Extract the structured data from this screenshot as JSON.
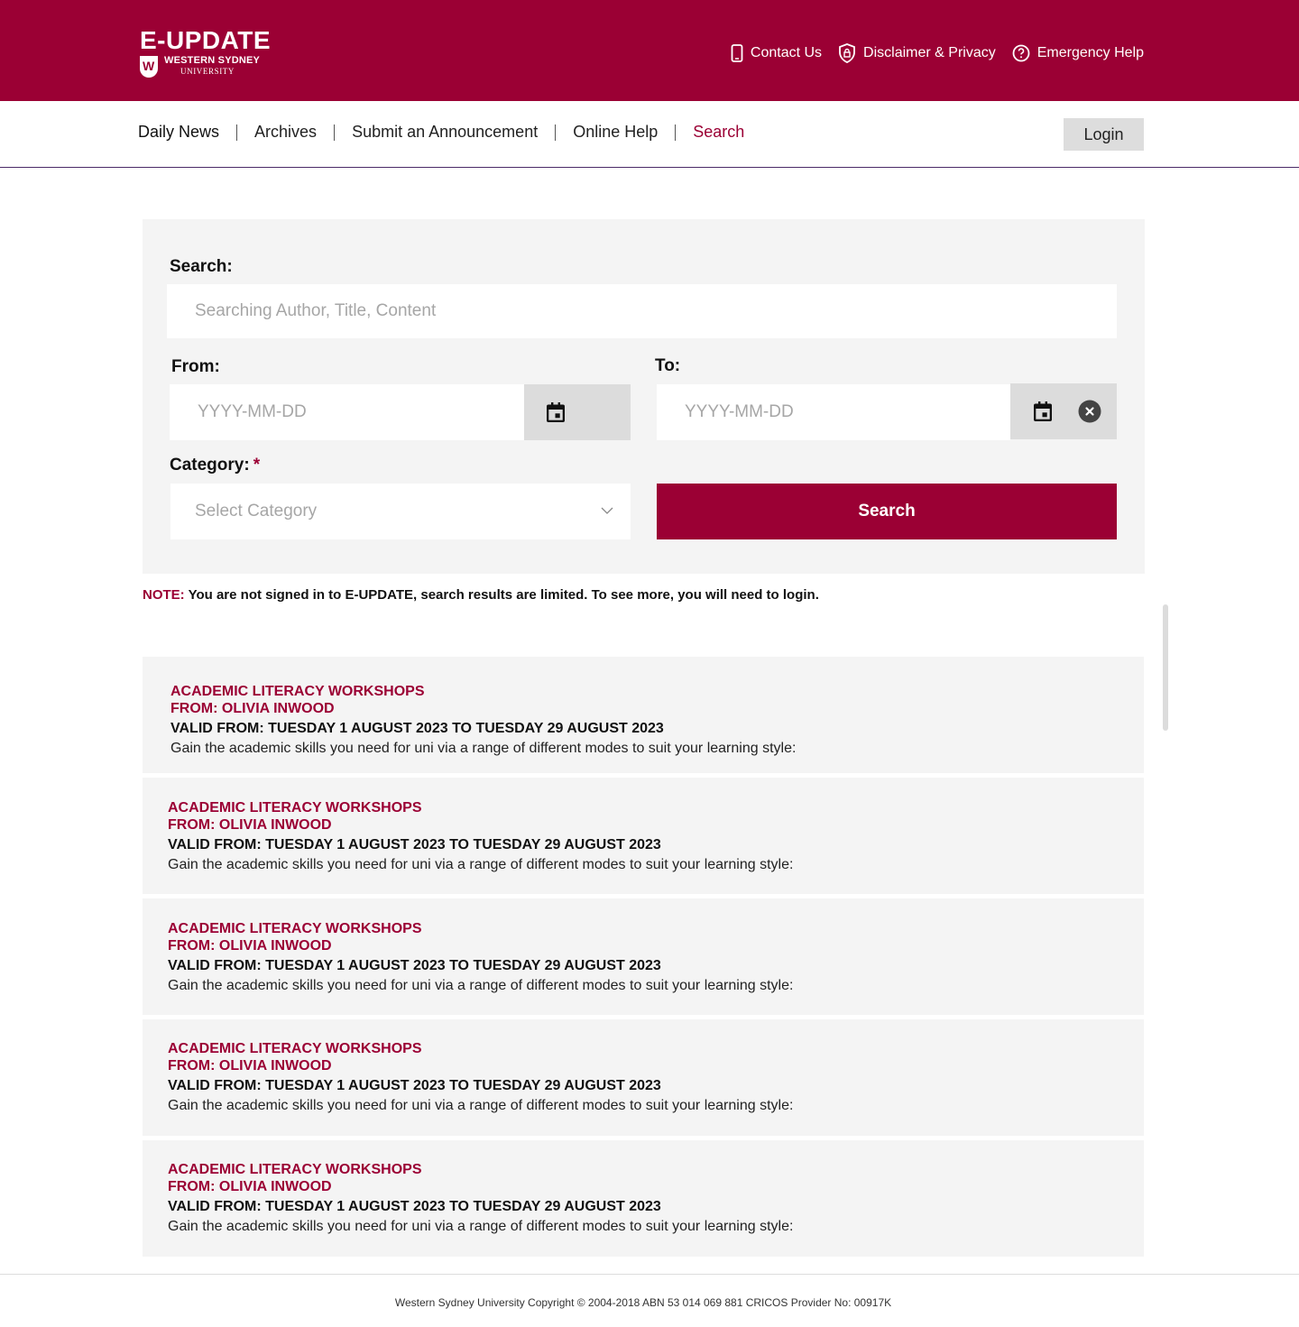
{
  "brand": {
    "title": "E-UPDATE",
    "university_line1": "WESTERN SYDNEY",
    "university_line2": "UNIVERSITY",
    "color": "#9b0034"
  },
  "header_links": [
    {
      "label": "Contact Us",
      "icon": "phone-icon"
    },
    {
      "label": "Disclaimer & Privacy",
      "icon": "shield-lock-icon"
    },
    {
      "label": "Emergency Help",
      "icon": "help-circle-icon"
    }
  ],
  "nav": {
    "items": [
      "Daily News",
      "Archives",
      "Submit an Announcement",
      "Online Help",
      "Search"
    ],
    "active": "Search",
    "login_label": "Login"
  },
  "search_form": {
    "search_label": "Search:",
    "search_placeholder": "Searching Author, Title, Content",
    "from_label": "From:",
    "from_placeholder": "YYYY-MM-DD",
    "to_label": "To:",
    "to_placeholder": "YYYY-MM-DD",
    "category_label": "Category:",
    "required_mark": "*",
    "category_placeholder": "Select Category",
    "submit_label": "Search"
  },
  "note": {
    "label": "NOTE:",
    "text": "You are not signed in to E-UPDATE, search results are limited. To see more, you will need to login."
  },
  "results": [
    {
      "title": "ACADEMIC LITERACY WORKSHOPS",
      "from": "FROM: OLIVIA INWOOD",
      "valid": "VALID FROM: TUESDAY 1 AUGUST 2023 TO TUESDAY 29 AUGUST 2023",
      "description": "Gain the academic skills you need for uni via a range of different modes to suit your learning style:"
    },
    {
      "title": "ACADEMIC LITERACY WORKSHOPS",
      "from": "FROM: OLIVIA INWOOD",
      "valid": "VALID FROM: TUESDAY 1 AUGUST 2023 TO TUESDAY 29 AUGUST 2023",
      "description": "Gain the academic skills you need for uni via a range of different modes to suit your learning style:"
    },
    {
      "title": "ACADEMIC LITERACY WORKSHOPS",
      "from": "FROM: OLIVIA INWOOD",
      "valid": "VALID FROM: TUESDAY 1 AUGUST 2023 TO TUESDAY 29 AUGUST 2023",
      "description": "Gain the academic skills you need for uni via a range of different modes to suit your learning style:"
    },
    {
      "title": "ACADEMIC LITERACY WORKSHOPS",
      "from": "FROM: OLIVIA INWOOD",
      "valid": "VALID FROM: TUESDAY 1 AUGUST 2023 TO TUESDAY 29 AUGUST 2023",
      "description": "Gain the academic skills you need for uni via a range of different modes to suit your learning style:"
    },
    {
      "title": "ACADEMIC LITERACY WORKSHOPS",
      "from": "FROM: OLIVIA INWOOD",
      "valid": "VALID FROM: TUESDAY 1 AUGUST 2023 TO TUESDAY 29 AUGUST 2023",
      "description": "Gain the academic skills you need for uni via a range of different modes to suit your learning style:"
    }
  ],
  "footer": {
    "text": "Western Sydney University Copyright © 2004-2018 ABN 53 014 069 881 CRICOS Provider No: 00917K"
  }
}
